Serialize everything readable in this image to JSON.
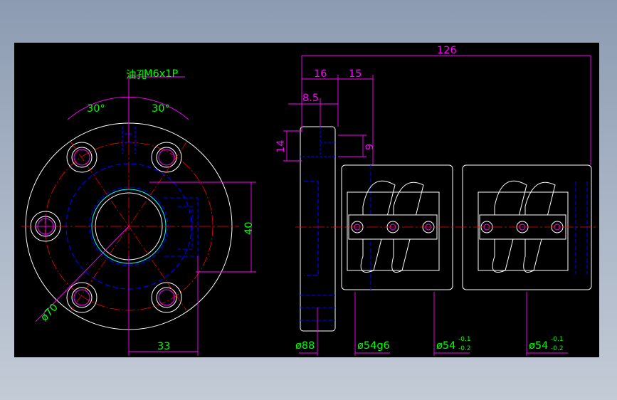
{
  "colors": {
    "background": "#000000",
    "outline": "#ffffff",
    "hidden": "#0000ff",
    "center": "#ff0000",
    "dimension": "#ff00ff",
    "text": "#00ff00",
    "highlight": "#00ffff"
  },
  "labels": {
    "oil_hole": "油孔",
    "thread": "M6x1P",
    "angle_left": "30°",
    "angle_right": "30°",
    "dim_40": "40",
    "dim_33": "33",
    "dim_70": "ø70",
    "dim_126": "126",
    "dim_16": "16",
    "dim_15": "15",
    "dim_8_5": "8.5",
    "dim_14": "14",
    "dim_9": "9",
    "dim_88": "ø88",
    "dim_54g6": "ø54g6",
    "dim_54_a": "ø54",
    "dim_54_b": "ø54",
    "tol_upper": "-0.1",
    "tol_lower": "-0.2"
  }
}
